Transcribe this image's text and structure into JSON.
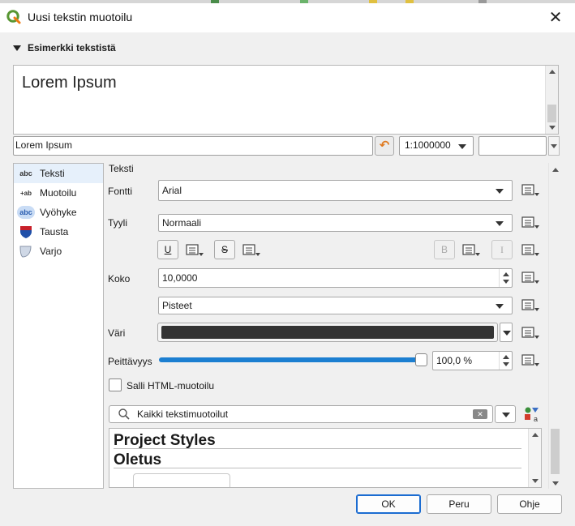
{
  "window": {
    "title": "Uusi tekstin muotoilu",
    "close_label": "✕"
  },
  "preview_section": {
    "header": "Esimerkki tekstistä",
    "sample_text": "Lorem Ipsum",
    "input_value": "Lorem Ipsum",
    "scale_value": "1:1000000"
  },
  "nav": {
    "items": [
      {
        "label": "Teksti",
        "icon": "abc-text-icon",
        "icon_text": "abc"
      },
      {
        "label": "Muotoilu",
        "icon": "formatting-icon",
        "icon_text": "+ab"
      },
      {
        "label": "Vyöhyke",
        "icon": "buffer-icon",
        "icon_text": "abc"
      },
      {
        "label": "Tausta",
        "icon": "background-shield-icon",
        "icon_text": ""
      },
      {
        "label": "Varjo",
        "icon": "shadow-icon",
        "icon_text": ""
      }
    ]
  },
  "text_tab": {
    "title": "Teksti",
    "font_label": "Fontti",
    "font_value": "Arial",
    "style_label": "Tyyli",
    "style_value": "Normaali",
    "underline_label": "U",
    "strike_label": "S",
    "bold_label": "B",
    "italic_label": "I",
    "size_label": "Koko",
    "size_value": "10,0000",
    "unit_value": "Pisteet",
    "color_label": "Väri",
    "color_value": "#333333",
    "opacity_label": "Peittävyys",
    "opacity_value": "100,0 %",
    "opacity_fraction": 1.0,
    "html_checkbox_label": "Salli HTML-muotoilu",
    "html_checked": false,
    "search_placeholder": "Kaikki tekstimuotoilut",
    "style_groups": [
      "Project Styles",
      "Oletus"
    ]
  },
  "footer": {
    "ok": "OK",
    "cancel": "Peru",
    "help": "Ohje"
  },
  "colors": {
    "accent": "#1c7fd1",
    "swatch": "#333333",
    "reset": "#e07a20"
  }
}
